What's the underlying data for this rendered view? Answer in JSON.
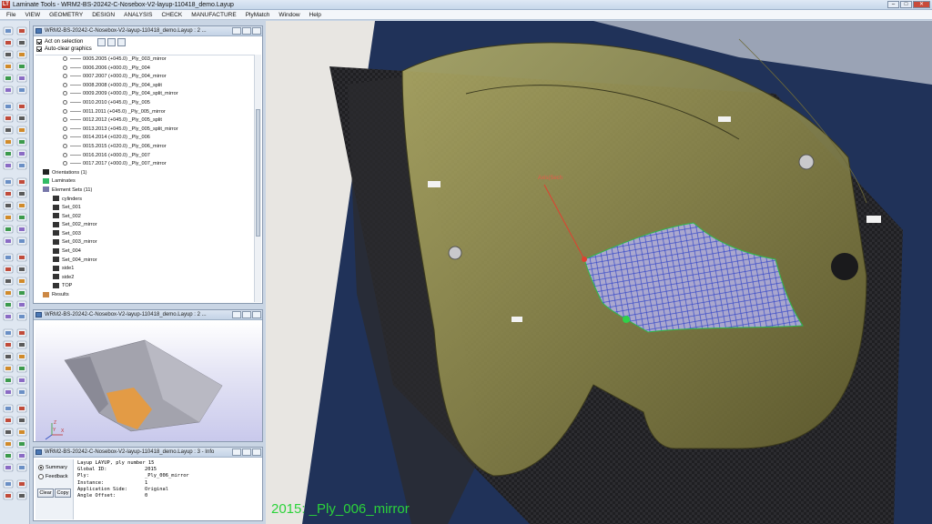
{
  "window": {
    "title": "Laminate Tools - WRM2-BS-20242-C-Nosebox-V2-layup-110418_demo.Layup",
    "logo": "LT",
    "controls": [
      "minimize",
      "maximize",
      "close"
    ]
  },
  "menu": [
    "File",
    "VIEW",
    "GEOMETRY",
    "DESIGN",
    "ANALYSIS",
    "CHECK",
    "MANUFACTURE",
    "PlyMatch",
    "Window",
    "Help"
  ],
  "tree_panel": {
    "title": "WRM2-BS-20242-C-Nosebox-V2-layup-110418_demo.Layup : 2 ...",
    "options": [
      {
        "label": "Act on selection",
        "checked": true
      },
      {
        "label": "Auto-clear graphics",
        "checked": true
      }
    ],
    "rows": [
      {
        "text": "0005.2005 (+045.0)  _Ply_003_mirror",
        "indent": 2,
        "kind": "ply"
      },
      {
        "text": "0006.2006 (+000.0)  _Ply_004",
        "indent": 2,
        "kind": "ply"
      },
      {
        "text": "0007.2007 (+000.0)  _Ply_004_mirror",
        "indent": 2,
        "kind": "ply"
      },
      {
        "text": "0008.2008 (+000.0)  _Ply_004_split",
        "indent": 2,
        "kind": "ply"
      },
      {
        "text": "0009.2009 (+000.0)  _Ply_004_split_mirror",
        "indent": 2,
        "kind": "ply"
      },
      {
        "text": "0010.2010 (+045.0)  _Ply_005",
        "indent": 2,
        "kind": "ply"
      },
      {
        "text": "0011.2011 (+045.0)  _Ply_005_mirror",
        "indent": 2,
        "kind": "ply"
      },
      {
        "text": "0012.2012 (+045.0)  _Ply_005_split",
        "indent": 2,
        "kind": "ply"
      },
      {
        "text": "0013.2013 (+045.0)  _Ply_005_split_mirror",
        "indent": 2,
        "kind": "ply"
      },
      {
        "text": "0014.2014 (+020.0)  _Ply_006",
        "indent": 2,
        "kind": "ply"
      },
      {
        "text": "0015.2015 (+020.0)  _Ply_006_mirror",
        "indent": 2,
        "kind": "ply"
      },
      {
        "text": "0016.2016 (+000.0)  _Ply_007",
        "indent": 2,
        "kind": "ply"
      },
      {
        "text": "0017.2017 (+000.0)  _Ply_007_mirror",
        "indent": 2,
        "kind": "ply"
      },
      {
        "text": "Orientations (1)",
        "indent": 0,
        "kind": "orient"
      },
      {
        "text": "Laminates",
        "indent": 0,
        "kind": "lam"
      },
      {
        "text": "Element Sets (11)",
        "indent": 0,
        "kind": "eset"
      },
      {
        "text": "cylinders",
        "indent": 1,
        "kind": "set"
      },
      {
        "text": "Set_001",
        "indent": 1,
        "kind": "set"
      },
      {
        "text": "Set_002",
        "indent": 1,
        "kind": "set"
      },
      {
        "text": "Set_002_mirror",
        "indent": 1,
        "kind": "set"
      },
      {
        "text": "Set_003",
        "indent": 1,
        "kind": "set"
      },
      {
        "text": "Set_003_mirror",
        "indent": 1,
        "kind": "set"
      },
      {
        "text": "Set_004",
        "indent": 1,
        "kind": "set"
      },
      {
        "text": "Set_004_mirror",
        "indent": 1,
        "kind": "set"
      },
      {
        "text": "side1",
        "indent": 1,
        "kind": "set"
      },
      {
        "text": "side2",
        "indent": 1,
        "kind": "set"
      },
      {
        "text": "TOP",
        "indent": 1,
        "kind": "set"
      },
      {
        "text": "Results",
        "indent": 0,
        "kind": "results"
      }
    ]
  },
  "preview_panel": {
    "title": "WRM2-BS-20242-C-Nosebox-V2-layup-110418_demo.Layup : 2 ...",
    "axis": {
      "x": "X",
      "y": "Y",
      "z": "Z"
    }
  },
  "info_panel": {
    "title": "WRM2-BS-20242-C-Nosebox-V2-layup-110418_demo.Layup : 3 - Info",
    "radios": [
      {
        "label": "Summary",
        "selected": true
      },
      {
        "label": "Feedback",
        "selected": false
      }
    ],
    "buttons": {
      "clear": "Clear",
      "copy": "Copy"
    },
    "header": "Layup LAYUP, ply number 15",
    "fields": [
      {
        "k": "Global ID:",
        "v": "2015"
      },
      {
        "k": "Ply:",
        "v": "_Ply_006_mirror"
      },
      {
        "k": "Instance:",
        "v": "1"
      },
      {
        "k": "Application Side:",
        "v": "Original"
      },
      {
        "k": "Angle Offset:",
        "v": "0"
      }
    ]
  },
  "viewport": {
    "ply_caption": "2015: _Ply_006_mirror",
    "axis_label": "Axis(Sech",
    "caption_color": "#2bd33a"
  },
  "colors": {
    "accent": "#4a77b4",
    "overlay_mesh": "#3548c8",
    "overlay_surface": "#c8c060"
  }
}
